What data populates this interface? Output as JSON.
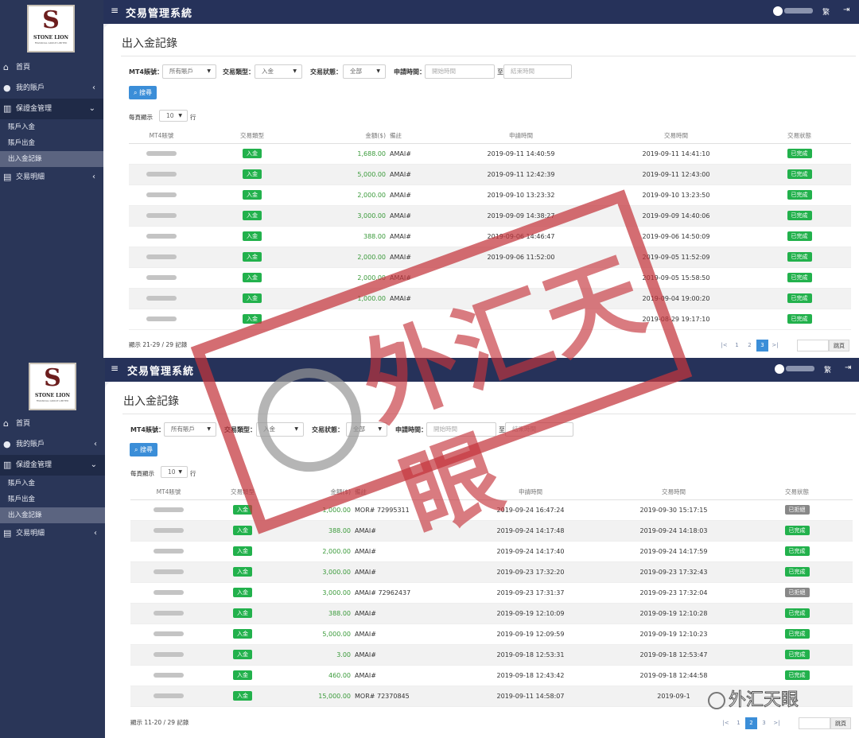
{
  "app": {
    "title": "交易管理系統",
    "menu_icon": "≡",
    "lang_label": "繁",
    "logout_icon": "logout-icon",
    "logo": {
      "mark": "S",
      "brand": "STONE LION",
      "sub": "FINANCIAL GROUP LIMITED"
    }
  },
  "sidebar": {
    "home": "首頁",
    "my_account": "我的賬戶",
    "margin_mgmt": "保證金管理",
    "deposit": "賬戶入金",
    "withdraw": "賬戶出金",
    "records": "出入金記錄",
    "trade_details": "交易明細"
  },
  "page": {
    "title": "出入金記錄",
    "filters": {
      "account_label": "MT4賬號：",
      "account_value": "所有賬戶",
      "type_label": "交易類型：",
      "type_value": "入金",
      "status_label": "交易狀態：",
      "status_value": "全部",
      "date_label": "申請時間：",
      "start_placeholder": "開始時間",
      "to_label": "至",
      "end_placeholder": "結束時間",
      "search_label": "搜尋",
      "per_page_prefix": "每頁顯示",
      "per_page_value": "10",
      "per_page_suffix": "行"
    },
    "columns": {
      "account": "MT4賬號",
      "type": "交易類型",
      "amount_1": "金額($)",
      "amount_2": "金額($)",
      "note": "備註",
      "apply_time": "申請時間",
      "trade_time": "交易時間",
      "status": "交易狀態"
    }
  },
  "colors": {
    "navbar": "#26325a",
    "sidebar": "#2a3658",
    "tag_green": "#22b14c",
    "tag_gray": "#888888",
    "amount_green": "#3a9a3a",
    "pager_blue": "#3b8ed8"
  },
  "records_1": {
    "rows": [
      {
        "type": "入金",
        "amount": "1,688.00",
        "note": "AMAI#",
        "apply": "2019-09-11 14:40:59",
        "trade": "2019-09-11 14:41:10",
        "status": "已完成",
        "status_kind": "done"
      },
      {
        "type": "入金",
        "amount": "5,000.00",
        "note": "AMAI#",
        "apply": "2019-09-11 12:42:39",
        "trade": "2019-09-11 12:43:00",
        "status": "已完成",
        "status_kind": "done"
      },
      {
        "type": "入金",
        "amount": "2,000.00",
        "note": "AMAI#",
        "apply": "2019-09-10 13:23:32",
        "trade": "2019-09-10 13:23:50",
        "status": "已完成",
        "status_kind": "done"
      },
      {
        "type": "入金",
        "amount": "3,000.00",
        "note": "AMAI#",
        "apply": "2019-09-09 14:38:27",
        "trade": "2019-09-09 14:40:06",
        "status": "已完成",
        "status_kind": "done"
      },
      {
        "type": "入金",
        "amount": "388.00",
        "note": "AMAI#",
        "apply": "2019-09-06 14:46:47",
        "trade": "2019-09-06 14:50:09",
        "status": "已完成",
        "status_kind": "done"
      },
      {
        "type": "入金",
        "amount": "2,000.00",
        "note": "AMAI#",
        "apply": "2019-09-06 11:52:00",
        "trade": "2019-09-05 11:52:09",
        "status": "已完成",
        "status_kind": "done"
      },
      {
        "type": "入金",
        "amount": "2,000.00",
        "note": "AMAI#",
        "apply": "",
        "trade": "2019-09-05 15:58:50",
        "status": "已完成",
        "status_kind": "done"
      },
      {
        "type": "入金",
        "amount": "1,000.00",
        "note": "AMAI#",
        "apply": "",
        "trade": "2019-09-04 19:00:20",
        "status": "已完成",
        "status_kind": "done"
      },
      {
        "type": "入金",
        "amount": "",
        "note": "",
        "apply": "",
        "trade": "2019-08-29 19:17:10",
        "status": "已完成",
        "status_kind": "done"
      }
    ],
    "summary": "顯示 21-29 / 29 記錄",
    "pages": [
      "|<",
      "1",
      "2",
      "3",
      ">|"
    ],
    "active_page": "3",
    "goto_label": "跳頁"
  },
  "records_2": {
    "rows": [
      {
        "type": "入金",
        "amount": "1,000.00",
        "note": "MOR# 72995311",
        "apply": "2019-09-24 16:47:24",
        "trade": "2019-09-30 15:17:15",
        "status": "已拒絕",
        "status_kind": "rejected"
      },
      {
        "type": "入金",
        "amount": "388.00",
        "note": "AMAI#",
        "apply": "2019-09-24 14:17:48",
        "trade": "2019-09-24 14:18:03",
        "status": "已完成",
        "status_kind": "done"
      },
      {
        "type": "入金",
        "amount": "2,000.00",
        "note": "AMAI#",
        "apply": "2019-09-24 14:17:40",
        "trade": "2019-09-24 14:17:59",
        "status": "已完成",
        "status_kind": "done"
      },
      {
        "type": "入金",
        "amount": "3,000.00",
        "note": "AMAI#",
        "apply": "2019-09-23 17:32:20",
        "trade": "2019-09-23 17:32:43",
        "status": "已完成",
        "status_kind": "done"
      },
      {
        "type": "入金",
        "amount": "3,000.00",
        "note": "AMAI# 72962437",
        "apply": "2019-09-23 17:31:37",
        "trade": "2019-09-23 17:32:04",
        "status": "已拒絕",
        "status_kind": "rejected"
      },
      {
        "type": "入金",
        "amount": "388.00",
        "note": "AMAI#",
        "apply": "2019-09-19 12:10:09",
        "trade": "2019-09-19 12:10:28",
        "status": "已完成",
        "status_kind": "done"
      },
      {
        "type": "入金",
        "amount": "5,000.00",
        "note": "AMAI#",
        "apply": "2019-09-19 12:09:59",
        "trade": "2019-09-19 12:10:23",
        "status": "已完成",
        "status_kind": "done"
      },
      {
        "type": "入金",
        "amount": "3.00",
        "note": "AMAI#",
        "apply": "2019-09-18 12:53:31",
        "trade": "2019-09-18 12:53:47",
        "status": "已完成",
        "status_kind": "done"
      },
      {
        "type": "入金",
        "amount": "460.00",
        "note": "AMAI#",
        "apply": "2019-09-18 12:43:42",
        "trade": "2019-09-18 12:44:58",
        "status": "已完成",
        "status_kind": "done"
      },
      {
        "type": "入金",
        "amount": "15,000.00",
        "note": "MOR# 72370845",
        "apply": "2019-09-11 14:58:07",
        "trade": "2019-09-1",
        "status": "",
        "status_kind": "done"
      }
    ],
    "summary": "顯示 11-20 / 29 記錄",
    "pages": [
      "|<",
      "1",
      "2",
      "3",
      ">|"
    ],
    "active_page": "2",
    "goto_label": "跳頁"
  },
  "overlay": {
    "stamp_text": "外汇天眼",
    "watermark_text": "外汇天眼"
  }
}
